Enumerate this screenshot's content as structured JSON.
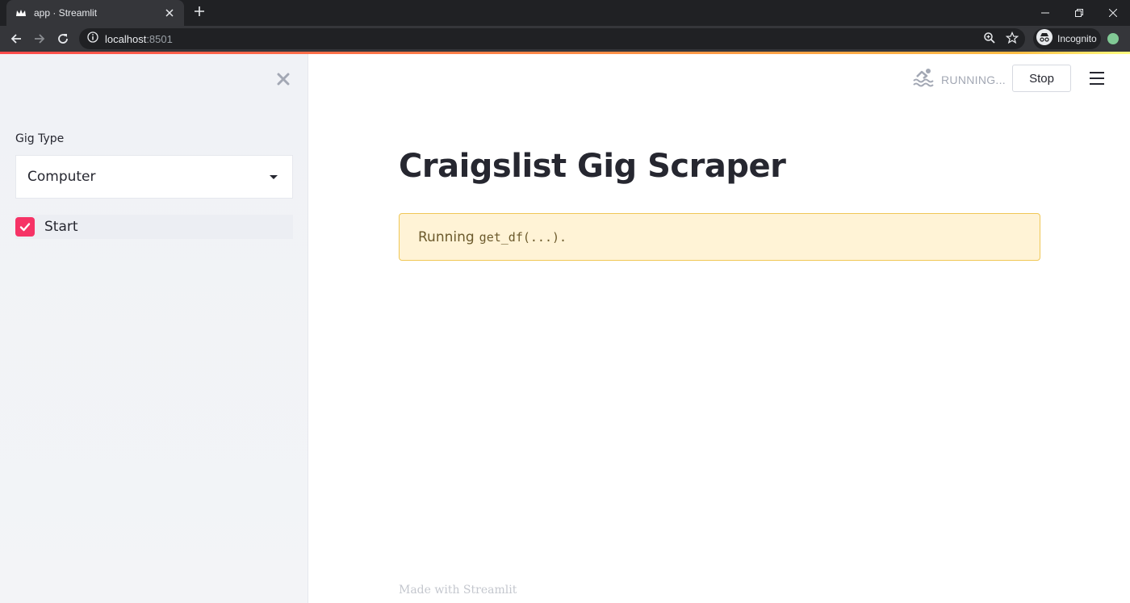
{
  "browser": {
    "tab_title": "app · Streamlit",
    "url_host": "localhost",
    "url_port": ":8501",
    "incognito_label": "Incognito"
  },
  "sidebar": {
    "field_label": "Gig Type",
    "select_value": "Computer",
    "checkbox_label": "Start",
    "checkbox_checked": true
  },
  "header": {
    "status_text": "RUNNING...",
    "stop_label": "Stop"
  },
  "main": {
    "title": "Craigslist Gig Scraper",
    "alert_prefix": "Running",
    "alert_code": "get_df(...).",
    "footer": "Made with Streamlit"
  },
  "colors": {
    "accent": "#f63366",
    "alert_bg": "#fff3d6",
    "alert_border": "#f0c756",
    "sidebar_bg": "#f0f2f6"
  },
  "icons": [
    "streamlit-favicon",
    "close-icon",
    "plus-icon",
    "minimize-icon",
    "restore-icon",
    "back-icon",
    "forward-icon",
    "reload-icon",
    "info-icon",
    "zoom-icon",
    "star-icon",
    "incognito-icon",
    "extension-icon",
    "swimmer-icon",
    "hamburger-icon",
    "checkmark-icon",
    "dropdown-arrow-icon"
  ]
}
